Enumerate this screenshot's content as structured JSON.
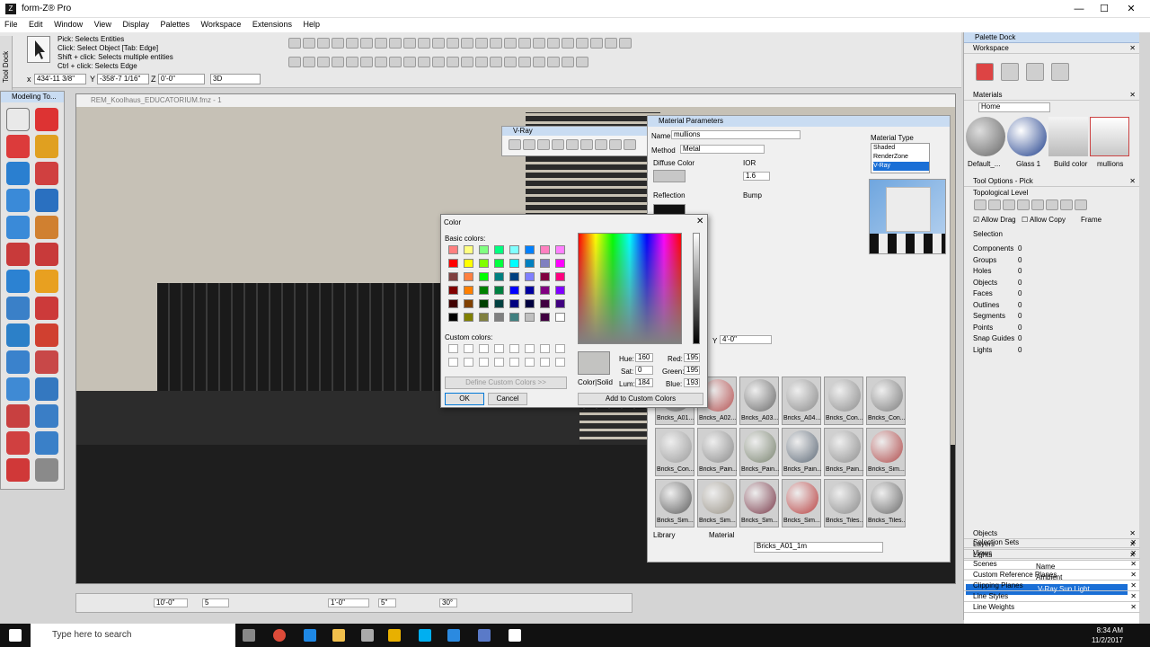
{
  "window": {
    "title": "form-Z® Pro",
    "controls": {
      "minimize": "—",
      "maximize": "☐",
      "close": "✕"
    }
  },
  "menu": [
    "File",
    "Edit",
    "Window",
    "View",
    "Display",
    "Palettes",
    "Workspace",
    "Extensions",
    "Help"
  ],
  "pick_hint": {
    "line1": "Pick:  Selects Entities",
    "line2": "Click: Select Object [Tab: Edge]",
    "line3": "Shift + click: Selects multiple entities",
    "line4": "Ctrl + click: Selects Edge"
  },
  "coords": {
    "x_label": "x",
    "x": "434'-11 3/8\"",
    "y_label": "Y",
    "y": "-358'-7 1/16\"",
    "z_label": "Z",
    "z": "0'-0\"",
    "view": "3D"
  },
  "side_tab": "Tool Dock",
  "modeling_tools": {
    "title": "Modeling To..."
  },
  "viewport": {
    "title": "REM_Koolhaus_EDUCATORIUM.fmz - 1"
  },
  "vray": {
    "title": "V-Ray"
  },
  "material_params": {
    "title": "Material Parameters",
    "name_label": "Name",
    "name_value": "mullions",
    "method_label": "Method",
    "method_value": "Metal",
    "type_label": "Material Type",
    "types": [
      "Shaded",
      "RenderZone",
      "V-Ray"
    ],
    "diffuse_label": "Diffuse Color",
    "ior_label": "IOR",
    "ior_value": "1.6",
    "reflection_label": "Reflection",
    "bump_label": "Bump",
    "y_label": "Y",
    "y_value": "4'-0\"",
    "library_label": "Library",
    "material_label": "Material",
    "material_value": "Bricks_A01_1m",
    "tiles": [
      "Bricks_A01...",
      "Bricks_A02...",
      "Bricks_A03...",
      "Bricks_A04...",
      "Bricks_Con...",
      "Bricks_Con...",
      "Bricks_Con...",
      "Bricks_Pain...",
      "Bricks_Pain...",
      "Bricks_Pain...",
      "Bricks_Pain...",
      "Bricks_Sim...",
      "Bricks_Sim...",
      "Bricks_Sim...",
      "Bricks_Sim...",
      "Bricks_Sim...",
      "Bricks_Tiles...",
      "Bricks_Tiles..."
    ]
  },
  "color_dialog": {
    "title": "Color",
    "basic_label": "Basic colors:",
    "custom_label": "Custom colors:",
    "define_btn": "Define Custom Colors >>",
    "ok_btn": "OK",
    "cancel_btn": "Cancel",
    "color_solid_label": "Color|Solid",
    "hue_label": "Hue:",
    "hue": "160",
    "sat_label": "Sat:",
    "sat": "0",
    "lum_label": "Lum:",
    "lum": "184",
    "red_label": "Red:",
    "red": "195",
    "green_label": "Green:",
    "green": "195",
    "blue_label": "Blue:",
    "blue": "193",
    "add_btn": "Add to Custom Colors",
    "selected_color": "#c3c3c1",
    "basic_colors": [
      "#ff8080",
      "#ffff80",
      "#80ff80",
      "#00ff80",
      "#80ffff",
      "#0080ff",
      "#ff80c0",
      "#ff80ff",
      "#ff0000",
      "#ffff00",
      "#80ff00",
      "#00ff40",
      "#00ffff",
      "#0080c0",
      "#8080c0",
      "#ff00ff",
      "#804040",
      "#ff8040",
      "#00ff00",
      "#008080",
      "#004080",
      "#8080ff",
      "#800040",
      "#ff0080",
      "#800000",
      "#ff8000",
      "#008000",
      "#008040",
      "#0000ff",
      "#0000a0",
      "#800080",
      "#8000ff",
      "#400000",
      "#804000",
      "#004000",
      "#004040",
      "#000080",
      "#000040",
      "#400040",
      "#400080",
      "#000000",
      "#808000",
      "#808040",
      "#808080",
      "#408080",
      "#c0c0c0",
      "#400040",
      "#ffffff"
    ]
  },
  "dock": {
    "title": "Palette Dock",
    "workspace": "Workspace",
    "materials": "Materials",
    "materials_dropdown": "Home",
    "swatches": [
      "Default_...",
      "Glass 1",
      "Build color",
      "mullions"
    ],
    "tool_options": "Tool Options - Pick",
    "topo_label": "Topological Level",
    "allow_drag": "Allow Drag",
    "allow_copy": "Allow Copy",
    "frame": "Frame",
    "selection": "Selection",
    "sel_rows": [
      {
        "label": "Components",
        "value": "0"
      },
      {
        "label": "Groups",
        "value": "0"
      },
      {
        "label": "Holes",
        "value": "0"
      },
      {
        "label": "Objects",
        "value": "0"
      },
      {
        "label": "Faces",
        "value": "0"
      },
      {
        "label": "Outlines",
        "value": "0"
      },
      {
        "label": "Segments",
        "value": "0"
      },
      {
        "label": "Points",
        "value": "0"
      },
      {
        "label": "Snap Guides",
        "value": "0"
      },
      {
        "label": "Lights",
        "value": "0"
      }
    ],
    "objects": "Objects",
    "layers": "Layers",
    "lights": "Lights",
    "lights_name_col": "Name",
    "light_rows": [
      "Ambient",
      "V-Ray Sun Light"
    ],
    "bottom_sections": [
      "Selection Sets",
      "Views",
      "Scenes",
      "Custom Reference Planes",
      "Clipping Planes",
      "Line Styles",
      "Line Weights"
    ]
  },
  "bottombar": {
    "v1": "10'-0\"",
    "v2": "5",
    "v3": "1'-0\"",
    "v4": "5\"",
    "v5": "30°"
  },
  "taskbar": {
    "search": "Type here to search",
    "time": "8:34 AM",
    "date": "11/2/2017"
  }
}
